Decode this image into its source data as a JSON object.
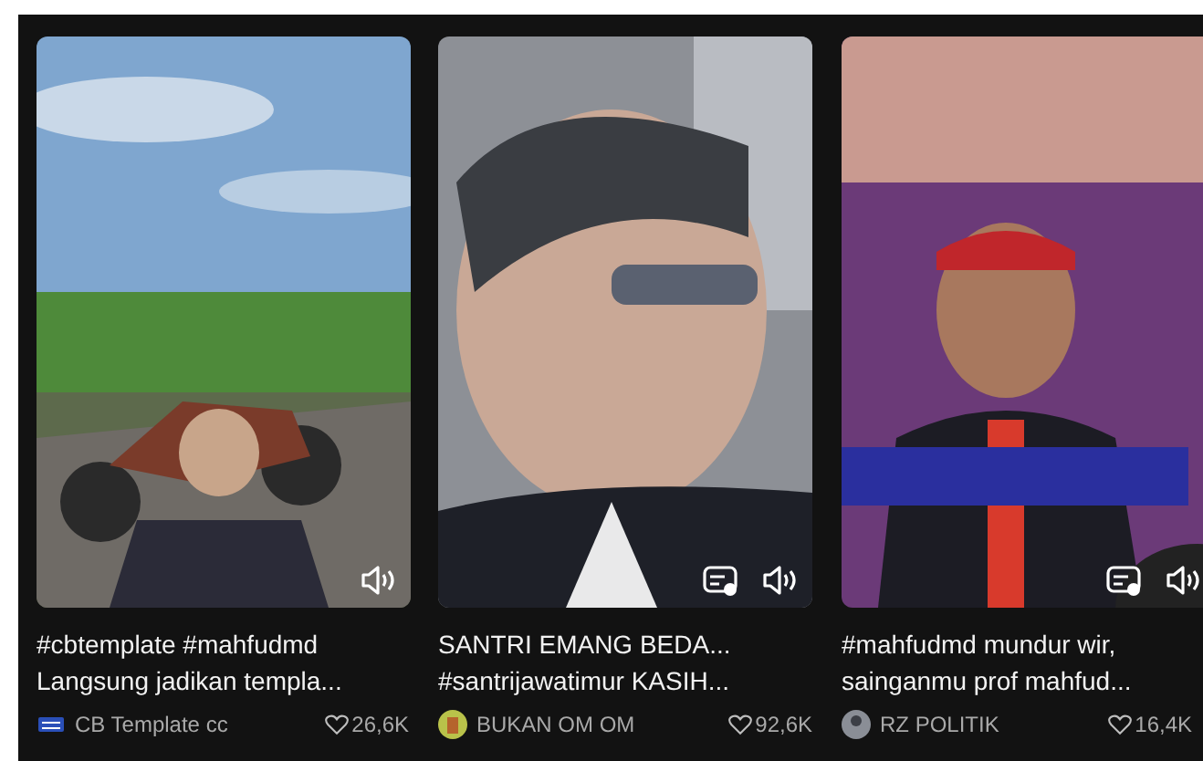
{
  "videos": [
    {
      "caption_lines": [
        "#cbtemplate #mahfudmd",
        "Langsung jadikan templa..."
      ],
      "author": "CB Template cc",
      "likes": "26,6K",
      "captions_icon": false
    },
    {
      "caption_lines": [
        "SANTRI EMANG BEDA...",
        "#santrijawatimur KASIH..."
      ],
      "author": "BUKAN OM OM",
      "likes": "92,6K",
      "captions_icon": true
    },
    {
      "caption_lines": [
        "#mahfudmd mundur wir,",
        "sainganmu prof mahfud..."
      ],
      "author": "RZ POLITIK",
      "likes": "16,4K",
      "captions_icon": true
    }
  ]
}
